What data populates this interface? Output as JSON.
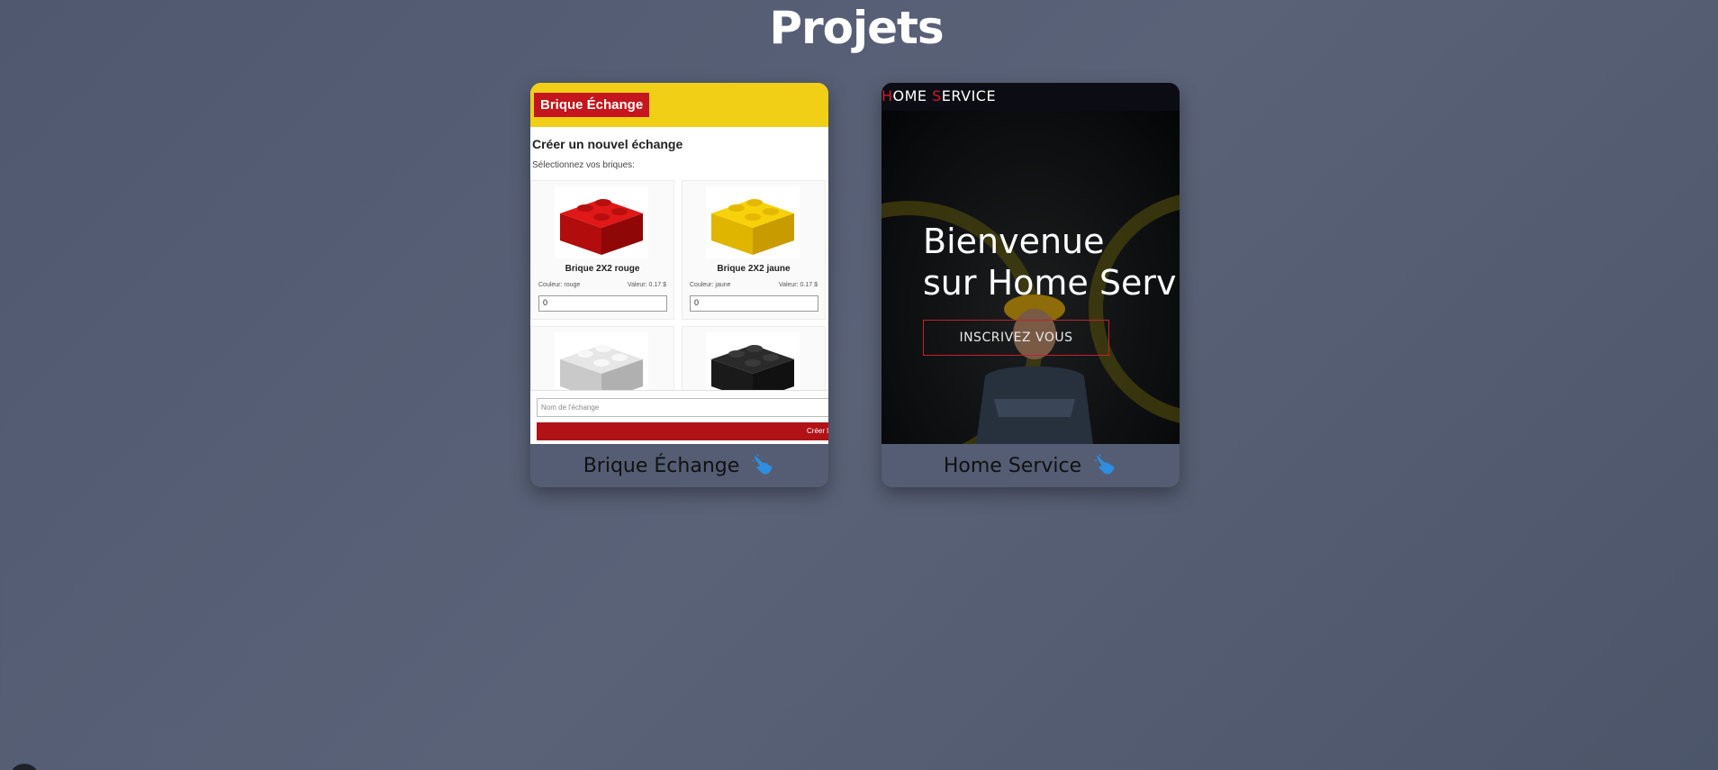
{
  "page": {
    "title": "Projets"
  },
  "projects": [
    {
      "name": "Brique Échange",
      "preview": {
        "brand": "Brique Échange",
        "heading": "Créer un nouvel échange",
        "subheading": "Sélectionnez vos briques:",
        "bricks": [
          {
            "name": "Brique 2X2 rouge",
            "color_label": "Couleur: rouge",
            "value_label": "Valeur: 0.17 $",
            "qty": "0",
            "color": "#d00d0d"
          },
          {
            "name": "Brique 2X2 jaune",
            "color_label": "Couleur: jaune",
            "value_label": "Valeur: 0.17 $",
            "qty": "0",
            "color": "#f2c500"
          },
          {
            "color": "#d8d8d8"
          },
          {
            "color": "#222222"
          }
        ],
        "exchange_name_placeholder": "Nom de l'échange",
        "create_button": "Créer l'é"
      }
    },
    {
      "name": "Home Service",
      "preview": {
        "nav_brand": {
          "h": "H",
          "ome": "OME ",
          "s": "S",
          "ervice": "ERVICE"
        },
        "hero_title_line1": "Bienvenue",
        "hero_title_line2": "sur Home Serv",
        "cta": "INSCRIVEZ VOUS"
      }
    }
  ],
  "colors": {
    "accent_red": "#c4161c",
    "accent_yellow": "#f0cf16",
    "pointer_blue": "#2e8ee0"
  },
  "icons": {
    "card_action": "pointing-hand-icon"
  }
}
